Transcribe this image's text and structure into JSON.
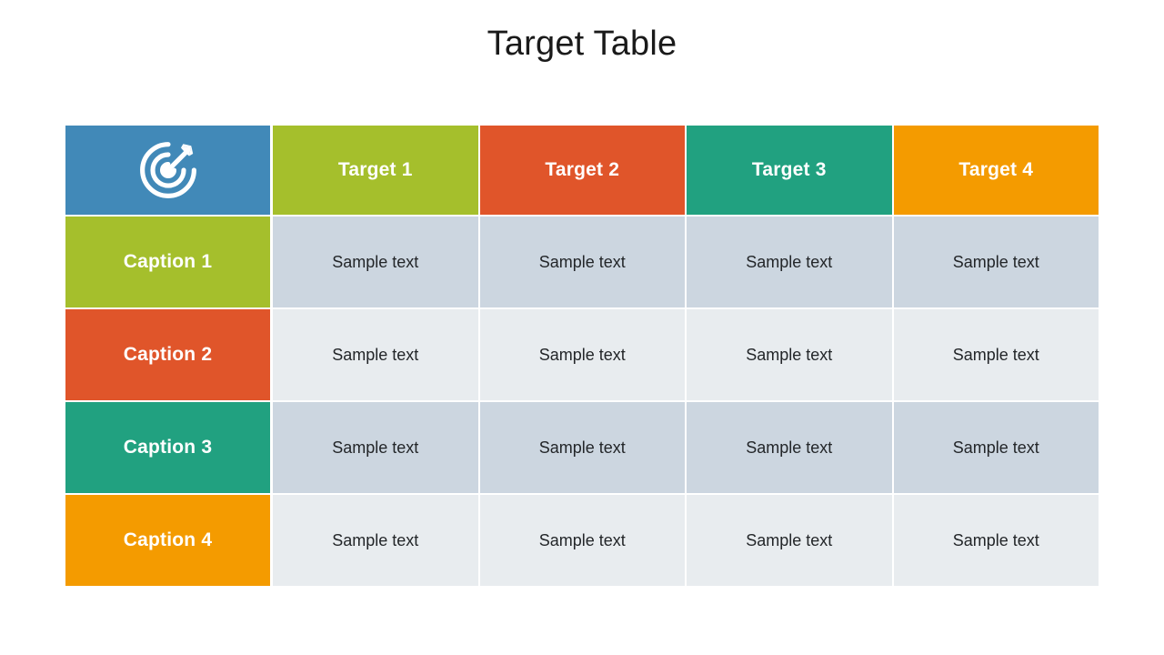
{
  "slide": {
    "title": "Target Table",
    "background": "#ffffff"
  },
  "palette": {
    "blue": "#4189b8",
    "green": "#a5bf2c",
    "red": "#e0552a",
    "teal": "#21a180",
    "orange": "#f49b00",
    "body_dark": "#ccd6e0",
    "body_light": "#e8ecef",
    "header_text": "#ffffff",
    "body_text": "#232629",
    "title_text": "#1a1a1a"
  },
  "table": {
    "corner": {
      "icon": "target-icon",
      "color": "#4189b8"
    },
    "column_headers": [
      {
        "label": "Target 1",
        "color": "#a5bf2c"
      },
      {
        "label": "Target 2",
        "color": "#e0552a"
      },
      {
        "label": "Target 3",
        "color": "#21a180"
      },
      {
        "label": "Target 4",
        "color": "#f49b00"
      }
    ],
    "rows": [
      {
        "caption": "Caption 1",
        "caption_color": "#a5bf2c",
        "row_color": "#ccd6e0",
        "cells": [
          "Sample text",
          "Sample text",
          "Sample text",
          "Sample text"
        ]
      },
      {
        "caption": "Caption 2",
        "caption_color": "#e0552a",
        "row_color": "#e8ecef",
        "cells": [
          "Sample text",
          "Sample text",
          "Sample text",
          "Sample text"
        ]
      },
      {
        "caption": "Caption 3",
        "caption_color": "#21a180",
        "row_color": "#ccd6e0",
        "cells": [
          "Sample text",
          "Sample text",
          "Sample text",
          "Sample text"
        ]
      },
      {
        "caption": "Caption 4",
        "caption_color": "#f49b00",
        "row_color": "#e8ecef",
        "cells": [
          "Sample text",
          "Sample text",
          "Sample text",
          "Sample text"
        ]
      }
    ]
  }
}
